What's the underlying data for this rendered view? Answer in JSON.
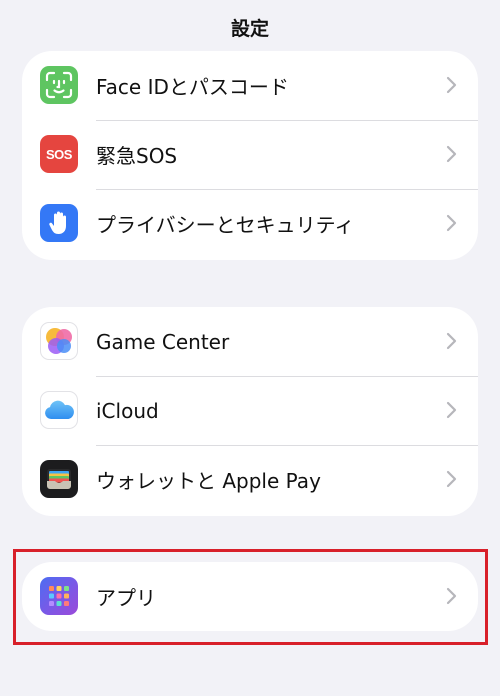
{
  "header": {
    "title": "設定"
  },
  "groups": [
    {
      "items": [
        {
          "label": "Face IDとパスコード",
          "icon": "faceid-icon",
          "color": "#5ec561"
        },
        {
          "label": "緊急SOS",
          "icon": "sos-icon",
          "icon_text": "SOS",
          "color": "#e5453f"
        },
        {
          "label": "プライバシーとセキュリティ",
          "icon": "hand-icon",
          "color": "#3478f6"
        }
      ]
    },
    {
      "items": [
        {
          "label": "Game Center",
          "icon": "game-center-icon"
        },
        {
          "label": "iCloud",
          "icon": "icloud-icon"
        },
        {
          "label": "ウォレットと Apple Pay",
          "icon": "wallet-icon"
        }
      ]
    },
    {
      "items": [
        {
          "label": "アプリ",
          "icon": "apps-icon"
        }
      ]
    }
  ],
  "highlight_color": "#d8202a"
}
